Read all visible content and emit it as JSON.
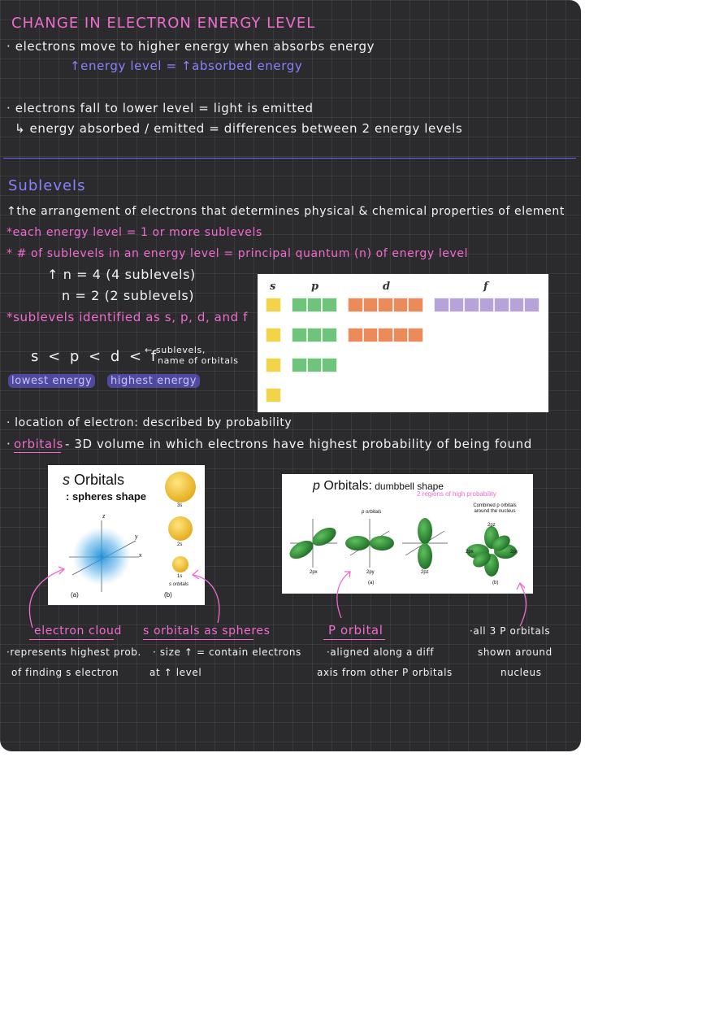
{
  "section1": {
    "title": "CHANGE IN ELECTRON ENERGY LEVEL",
    "line1": "· electrons move to higher energy when absorbs energy",
    "line1_note": "↑energy level = ↑absorbed energy",
    "line2": "· electrons fall to lower level = light is emitted",
    "line3": "↳ energy absorbed / emitted = differences between 2 energy levels"
  },
  "section2": {
    "title": "Sublevels",
    "def": "↑the arrangement of electrons that determines physical & chemical properties of element",
    "note1": "*each energy level = 1 or more sublevels",
    "note2": "* # of sublevels in an energy level = principal quantum (n) of energy level",
    "ex1": "↑ n = 4 (4 sublevels)",
    "ex2": "n = 2 (2 sublevels)",
    "note3": "*sublevels identified as s, p, d, and f",
    "order": "s < p < d < f",
    "order_note_1": "← sublevels,",
    "order_note_2": "name of orbitals",
    "lowest": "lowest energy",
    "highest": "highest energy"
  },
  "sublevel_table": {
    "headers": [
      "s",
      "p",
      "d",
      "f"
    ],
    "rows": [
      {
        "s": 1,
        "p": 3,
        "d": 5,
        "f": 7
      },
      {
        "s": 1,
        "p": 3,
        "d": 5,
        "f": 0
      },
      {
        "s": 1,
        "p": 3,
        "d": 0,
        "f": 0
      },
      {
        "s": 1,
        "p": 0,
        "d": 0,
        "f": 0
      }
    ],
    "colors": {
      "s": "#f3d34a",
      "p": "#6fc47b",
      "d": "#ec8a5a",
      "f": "#b7a3d8"
    }
  },
  "section3": {
    "loc": "· location of electron: described by probability",
    "orbitals_term": "orbitals",
    "orbitals_dot": "·",
    "orbitals_def": "- 3D volume in which electrons have highest probability of being found"
  },
  "s_orbitals_card": {
    "title_italic": "s",
    "title_rest": " Orbitals",
    "subtitle": ": spheres shape",
    "sphere_labels": [
      "3s",
      "2s",
      "1s"
    ],
    "caption_a": "(a)",
    "caption_b": "(b)",
    "caption_orbitals": "s orbitals",
    "axis_x": "x",
    "axis_y": "y",
    "axis_z": "z"
  },
  "p_orbitals_card": {
    "title_italic": "p",
    "title_rest": " Orbitals:",
    "title_shape": " dumbbell shape",
    "note": "2 regions of high probability",
    "label_porbitals": "p orbitals",
    "combined": "Combined p orbitals around the nucleus",
    "orbital_labels": [
      "2px",
      "2py",
      "2pz"
    ],
    "caption_a": "(a)",
    "caption_b": "(b)",
    "combined_labels": [
      "2pz",
      "2py",
      "2px"
    ]
  },
  "annotations": {
    "electron_cloud_title": "electron cloud",
    "electron_cloud_1": "·represents highest prob.",
    "electron_cloud_2": "of finding s electron",
    "s_spheres_title": "s orbitals as spheres",
    "s_spheres_1": "· size ↑ = contain electrons",
    "s_spheres_2": "at ↑ level",
    "p_orbital_title": "P orbital",
    "p_orbital_1": "·aligned along a diff",
    "p_orbital_2": "axis from other P orbitals",
    "all3_1": "·all 3 P orbitals",
    "all3_2": "shown around",
    "all3_3": "nucleus"
  }
}
